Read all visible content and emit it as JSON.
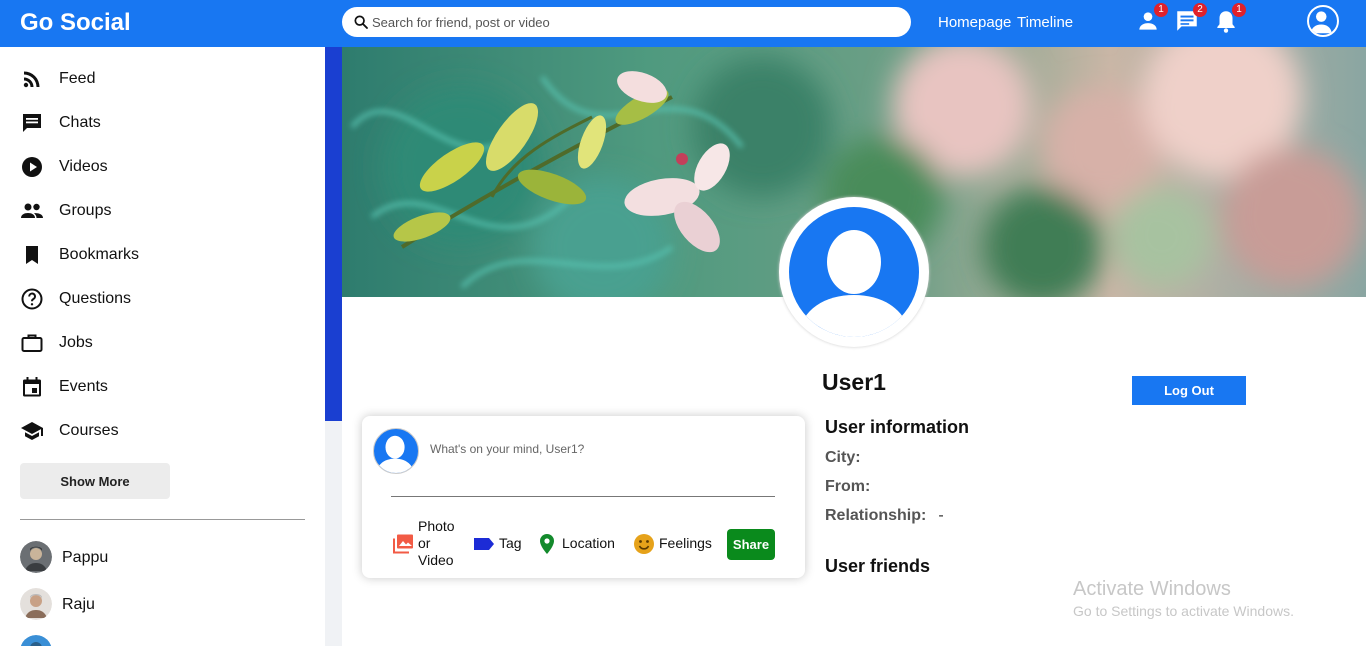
{
  "header": {
    "logo": "Go Social",
    "search_placeholder": "Search for friend, post or video",
    "links": [
      "Homepage",
      "Timeline"
    ],
    "icons": [
      {
        "name": "person-icon",
        "badge": "1"
      },
      {
        "name": "chat-icon",
        "badge": "2"
      },
      {
        "name": "bell-icon",
        "badge": "1"
      }
    ]
  },
  "sidebar": {
    "items": [
      {
        "label": "Feed",
        "icon": "rss-icon"
      },
      {
        "label": "Chats",
        "icon": "chat-icon"
      },
      {
        "label": "Videos",
        "icon": "play-circle-icon"
      },
      {
        "label": "Groups",
        "icon": "group-icon"
      },
      {
        "label": "Bookmarks",
        "icon": "bookmark-icon"
      },
      {
        "label": "Questions",
        "icon": "help-circle-icon"
      },
      {
        "label": "Jobs",
        "icon": "briefcase-icon"
      },
      {
        "label": "Events",
        "icon": "calendar-icon"
      },
      {
        "label": "Courses",
        "icon": "school-icon"
      }
    ],
    "show_more": "Show More",
    "friends": [
      {
        "name": "Pappu"
      },
      {
        "name": "Raju"
      }
    ]
  },
  "profile": {
    "username": "User1",
    "logout_label": "Log Out"
  },
  "share": {
    "placeholder": "What's on your mind, User1?",
    "options": {
      "photo_line1": "Photo",
      "photo_line2": "or",
      "photo_line3": "Video",
      "tag": "Tag",
      "location": "Location",
      "feelings": "Feelings"
    },
    "share_label": "Share"
  },
  "info": {
    "title": "User information",
    "city_label": "City:",
    "city_value": "",
    "from_label": "From:",
    "from_value": "",
    "relationship_label": "Relationship:",
    "relationship_value": "-",
    "friends_title": "User friends"
  },
  "watermark": {
    "line1": "Activate Windows",
    "line2": "Go to Settings to activate Windows."
  },
  "colors": {
    "brand": "#1877f2",
    "share": "#0a8a1c",
    "badge": "#e0212b"
  }
}
